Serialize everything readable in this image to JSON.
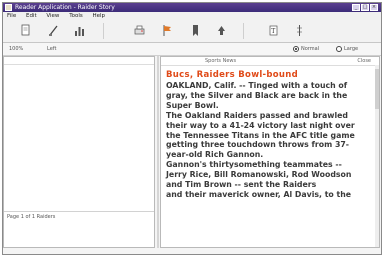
{
  "window": {
    "title": "Reader Application - Raider Story",
    "controls": [
      "_",
      "□",
      "×"
    ]
  },
  "menu": [
    "File",
    "Edit",
    "View",
    "Tools",
    "Help"
  ],
  "toolbar": {
    "buttons": [
      {
        "icon": "document-icon"
      },
      {
        "icon": "pencil-icon"
      },
      {
        "icon": "bar-chart-icon"
      },
      {
        "icon": "print-icon"
      },
      {
        "icon": "flag-icon"
      },
      {
        "icon": "bookmark-icon"
      },
      {
        "icon": "arrow-icon"
      },
      {
        "icon": "text-icon"
      },
      {
        "icon": "ruler-icon"
      }
    ]
  },
  "formatbar": {
    "left_text": "100%",
    "mid_text": "Left",
    "radio1_label": "Normal",
    "radio2_label": "Large"
  },
  "left_pane": {
    "footer_text": "Page 1 of 1  Raiders"
  },
  "right_pane": {
    "header_left": "Sports  News",
    "header_right": "Close",
    "headline": "Bucs, Raiders Bowl-bound",
    "lines": [
      "OAKLAND, Calif. -- Tinged with a touch of",
      "gray, the Silver and Black are back in the",
      "Super Bowl.",
      "The Oakland Raiders passed and brawled",
      "their way to a 41-24 victory last night over",
      "the Tennessee Titans in the AFC title game",
      "getting three touchdown throws from 37-",
      "year-old Rich Gannon.",
      "Gannon's thirtysomething teammates --",
      "Jerry Rice, Bill Romanowski, Rod Woodson",
      "and Tim Brown -- sent the Raiders",
      "and their maverick owner, Al Davis, to the"
    ]
  }
}
